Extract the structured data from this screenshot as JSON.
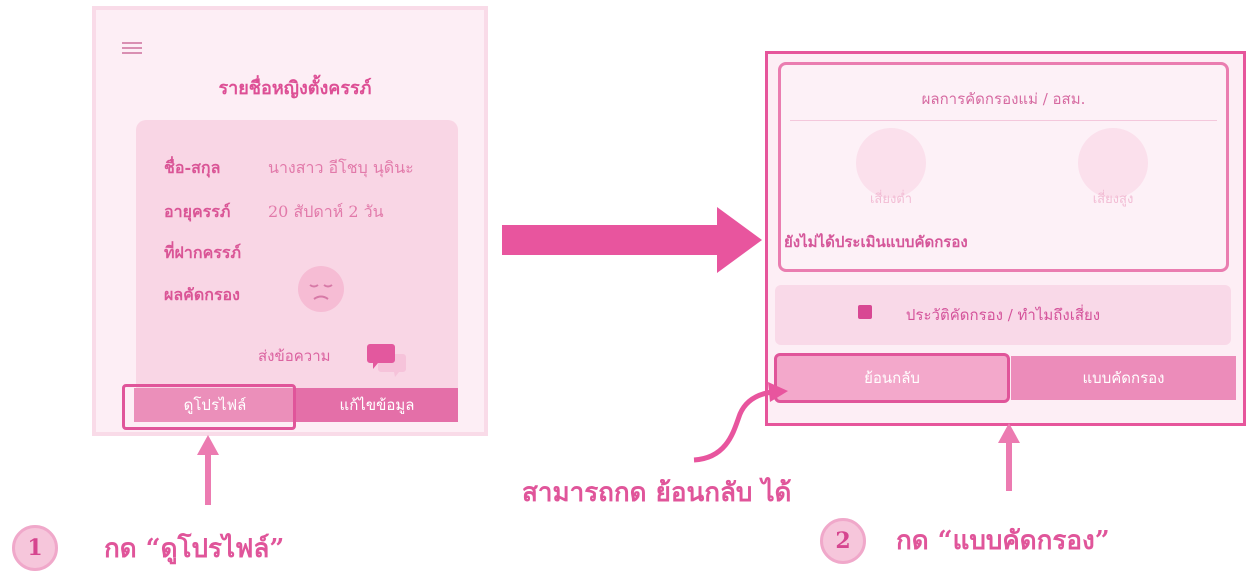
{
  "left_screen": {
    "title": "รายชื่อหญิงตั้งครรภ์",
    "fields": [
      {
        "label": "ชื่อ-สกุล",
        "value": "นางสาว อีโชบุ นุดินะ"
      },
      {
        "label": "อายุครรภ์",
        "value": "20 สัปดาห์ 2 วัน"
      },
      {
        "label": "ที่ฝากครรภ์",
        "value": ""
      },
      {
        "label": "ผลคัดกรอง",
        "value": ""
      }
    ],
    "send_message": "ส่งข้อความ",
    "view_profile": "ดูโปรไฟล์",
    "edit_info": "แก้ไขข้อมูล"
  },
  "right_screen": {
    "result_title": "ผลการคัดกรองแม่ / อสม.",
    "low_risk": "เสี่ยงต่ำ",
    "high_risk": "เสี่ยงสูง",
    "not_assessed": "ยังไม่ได้ประเมินแบบคัดกรอง",
    "history": "ประวัติคัดกรอง / ทำไมถึงเสี่ยง",
    "back": "ย้อนกลับ",
    "screening_form": "แบบคัดกรอง"
  },
  "annotations": {
    "hint_back": "สามารถกด ย้อนกลับ ได้",
    "step1_number": "1",
    "step1_text": "กด “ดูโปรไฟล์”",
    "step2_number": "2",
    "step2_text": "กด “แบบคัดกรอง”"
  },
  "colors": {
    "accent": "#e0559a",
    "panel": "#fdeef5",
    "card": "#f9d6e5"
  }
}
